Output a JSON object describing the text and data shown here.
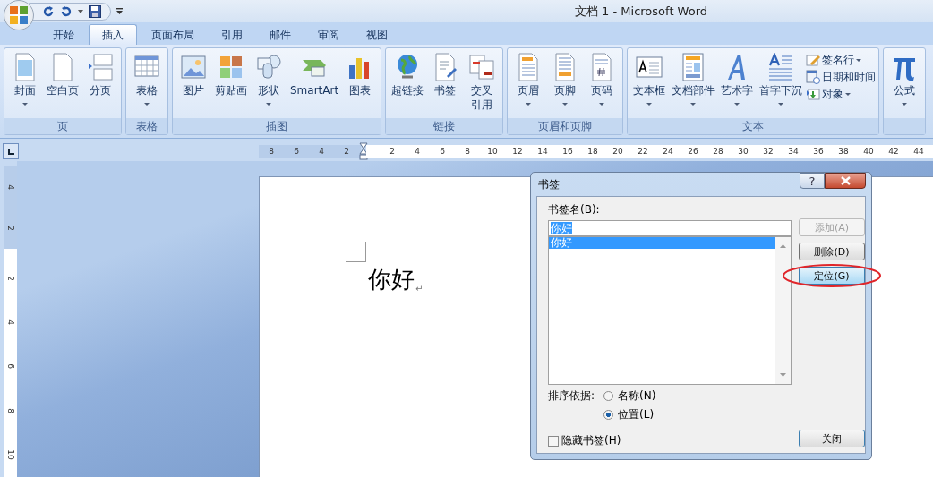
{
  "window": {
    "title": "文档 1 - Microsoft Word"
  },
  "tabs": [
    {
      "label": "开始",
      "selected": false
    },
    {
      "label": "插入",
      "selected": true
    },
    {
      "label": "页面布局",
      "selected": false
    },
    {
      "label": "引用",
      "selected": false
    },
    {
      "label": "邮件",
      "selected": false
    },
    {
      "label": "审阅",
      "selected": false
    },
    {
      "label": "视图",
      "selected": false
    }
  ],
  "ribbon_groups": [
    {
      "label": "页",
      "buttons": [
        {
          "label": "封面",
          "dropdown": true
        },
        {
          "label": "空白页",
          "dropdown": false
        },
        {
          "label": "分页",
          "dropdown": false
        }
      ]
    },
    {
      "label": "表格",
      "buttons": [
        {
          "label": "表格",
          "dropdown": true
        }
      ]
    },
    {
      "label": "插图",
      "buttons": [
        {
          "label": "图片",
          "dropdown": false
        },
        {
          "label": "剪贴画",
          "dropdown": false
        },
        {
          "label": "形状",
          "dropdown": true
        },
        {
          "label": "SmartArt",
          "dropdown": false
        },
        {
          "label": "图表",
          "dropdown": false
        }
      ]
    },
    {
      "label": "链接",
      "buttons": [
        {
          "label": "超链接",
          "dropdown": false
        },
        {
          "label": "书签",
          "dropdown": false
        },
        {
          "label": "交叉引用",
          "dropdown": false
        }
      ]
    },
    {
      "label": "页眉和页脚",
      "buttons": [
        {
          "label": "页眉",
          "dropdown": true
        },
        {
          "label": "页脚",
          "dropdown": true
        },
        {
          "label": "页码",
          "dropdown": true
        }
      ]
    },
    {
      "label": "文本",
      "buttons": [
        {
          "label": "文本框",
          "dropdown": true
        },
        {
          "label": "文档部件",
          "dropdown": true
        },
        {
          "label": "艺术字",
          "dropdown": true
        },
        {
          "label": "首字下沉",
          "dropdown": true
        }
      ],
      "small_buttons": [
        {
          "label": "签名行",
          "dropdown": true
        },
        {
          "label": "日期和时间",
          "dropdown": false
        },
        {
          "label": "对象",
          "dropdown": true
        }
      ]
    },
    {
      "buttons": [
        {
          "label": "公式",
          "dropdown": true
        }
      ]
    }
  ],
  "horizontal_ruler": {
    "left_labels": [
      "8",
      "6",
      "4",
      "2"
    ],
    "right_labels": [
      "2",
      "4",
      "6",
      "8",
      "10",
      "12",
      "14",
      "16",
      "18",
      "20",
      "22",
      "24",
      "26",
      "28",
      "30",
      "32",
      "34",
      "36",
      "38",
      "40",
      "42",
      "44"
    ]
  },
  "vertical_ruler": {
    "top_labels": [
      "4",
      "2"
    ],
    "bottom_labels": [
      "2",
      "4",
      "6",
      "8",
      "10"
    ]
  },
  "document": {
    "text": "你好",
    "paragraph_mark": "↵"
  },
  "dialog": {
    "title": "书签",
    "help_button": "?",
    "name_label": "书签名(B):",
    "name_field": {
      "value": "你好"
    },
    "bookmarks": [
      {
        "label": "你好",
        "selected": true
      }
    ],
    "buttons": [
      {
        "label": "添加(A)",
        "disabled": true,
        "circled": false
      },
      {
        "label": "删除(D)",
        "disabled": false,
        "circled": false
      },
      {
        "label": "定位(G)",
        "disabled": false,
        "circled": true
      }
    ],
    "sort": {
      "label": "排序依据:",
      "options": [
        {
          "label": "名称(N)",
          "selected": false
        },
        {
          "label": "位置(L)",
          "selected": true
        }
      ]
    },
    "hidden_checkbox": {
      "label": "隐藏书签(H)",
      "checked": false
    },
    "close_button": "关闭"
  }
}
